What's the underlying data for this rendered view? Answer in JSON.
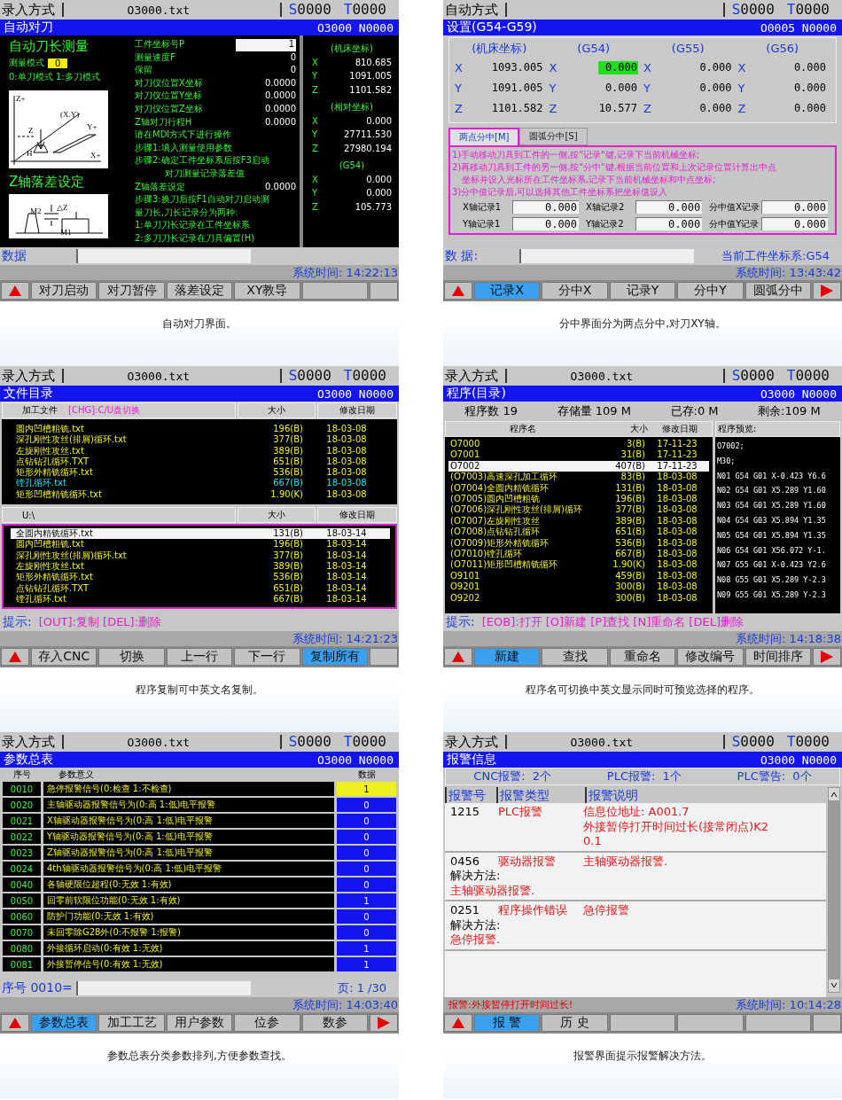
{
  "screens": [
    {
      "kind": "auto_tool",
      "status_bar": {
        "mode": "录入方式",
        "file": "O3000.txt",
        "codes": [
          {
            "letter": "S",
            "value": "0000"
          },
          {
            "letter": "T",
            "value": "0000"
          }
        ]
      },
      "title": "自动对刀",
      "program": "O3000 N0000",
      "heading": "自动刀长测量",
      "mode": {
        "label": "测量模式",
        "value": "0"
      },
      "mode_hint": "0:单刀模式 1:多刀模式",
      "diagram_labels": [
        "Z+",
        "(X.Y)",
        "Y+",
        "Z",
        "H",
        "X+"
      ],
      "heading2": "Z轴落差设定",
      "diagram2_labels": [
        "M2",
        "△Z",
        "M1"
      ],
      "params": [
        {
          "kind": "field",
          "label": "工件坐标号P",
          "value": "1"
        },
        {
          "kind": "value",
          "label": "测量速度F",
          "value": "0"
        },
        {
          "kind": "value",
          "label": "保留",
          "value": "0"
        },
        {
          "kind": "value",
          "label": "对刀仪位置X坐标",
          "value": "0.0000"
        },
        {
          "kind": "value",
          "label": "对刀仪位置Y坐标",
          "value": "0.0000"
        },
        {
          "kind": "value",
          "label": "对刀仪位置Z坐标",
          "value": "0.0000"
        },
        {
          "kind": "value",
          "label": "Z轴对刀行程H",
          "value": "0.0000"
        },
        {
          "kind": "note",
          "label": "请在MDI方式下进行操作"
        },
        {
          "kind": "note",
          "label": "步骤1:填入测量使用参数"
        },
        {
          "kind": "note",
          "label": "步骤2:确定工件坐标系后按F3启动"
        },
        {
          "kind": "indent",
          "label": "对刀测量记录落差值"
        },
        {
          "kind": "value",
          "label": "Z轴落差设定",
          "value": "0.0000"
        },
        {
          "kind": "note",
          "label": "步骤3:换刀后按F1自动对刀启动测"
        },
        {
          "kind": "note",
          "label": "量刀长,刀长记录分为两种:"
        },
        {
          "kind": "note",
          "label": "1:单刀刀长记录在工件坐标系"
        },
        {
          "kind": "note",
          "label": "2:多刀刀长记录在刀具偏置(H)"
        }
      ],
      "coords": [
        {
          "title": "(机床坐标)",
          "axes": [
            {
              "axis": "X",
              "value": "810.685"
            },
            {
              "axis": "Y",
              "value": "1091.005"
            },
            {
              "axis": "Z",
              "value": "1101.582"
            }
          ]
        },
        {
          "title": "(相对坐标)",
          "axes": [
            {
              "axis": "X",
              "value": "0.000"
            },
            {
              "axis": "Y",
              "value": "27711.530"
            },
            {
              "axis": "Z",
              "value": "27980.194"
            }
          ]
        },
        {
          "title": "(G54)",
          "axes": [
            {
              "axis": "X",
              "value": "0.000"
            },
            {
              "axis": "Y",
              "value": "0.000"
            },
            {
              "axis": "Z",
              "value": "105.773"
            }
          ]
        }
      ],
      "data_line": {
        "label": "数据"
      },
      "time": "系统时间: 14:22:13",
      "softkeys": [
        {
          "label": "对刀启动",
          "selected": false
        },
        {
          "label": "对刀暂停",
          "selected": false
        },
        {
          "label": "落差设定",
          "selected": false
        },
        {
          "label": "XY教导",
          "selected": false
        }
      ],
      "next_page": false,
      "caption": "自动对刀界面。"
    },
    {
      "kind": "offset",
      "status_bar": {
        "mode": "自动方式",
        "codes": [
          {
            "letter": "S",
            "value": "0000"
          },
          {
            "letter": "T",
            "value": "0000"
          }
        ]
      },
      "title": "设置(G54-G59)",
      "program": "O0005 N0000",
      "columns": [
        {
          "title": "(机床坐标)",
          "cells": [
            {
              "axis": "X",
              "value": "1093.005",
              "selected": false
            },
            {
              "axis": "Y",
              "value": "1091.005",
              "selected": false
            },
            {
              "axis": "Z",
              "value": "1101.582",
              "selected": false
            }
          ]
        },
        {
          "title": "(G54)",
          "cells": [
            {
              "axis": "X",
              "value": "0.000",
              "selected": true
            },
            {
              "axis": "Y",
              "value": "0.000",
              "selected": false
            },
            {
              "axis": "Z",
              "value": "10.577",
              "selected": false
            }
          ]
        },
        {
          "title": "(G55)",
          "cells": [
            {
              "axis": "X",
              "value": "0.000",
              "selected": false
            },
            {
              "axis": "Y",
              "value": "0.000",
              "selected": false
            },
            {
              "axis": "Z",
              "value": "0.000",
              "selected": false
            }
          ]
        },
        {
          "title": "(G56)",
          "cells": [
            {
              "axis": "X",
              "value": "0.000",
              "selected": false
            },
            {
              "axis": "Y",
              "value": "0.000",
              "selected": false
            },
            {
              "axis": "Z",
              "value": "0.000",
              "selected": false
            }
          ]
        }
      ],
      "tabs": [
        {
          "label": "两点分中[M]",
          "selected": true
        },
        {
          "label": "圆弧分中[S]",
          "selected": false
        }
      ],
      "instructions": [
        "1)手动移动刀具到工件的一侧,按\"记录\"键,记录下当前机械坐标;",
        "2)再移动刀具到工件的另一侧,按\"分中\"键,根据当前位置和上次记录位置计算出中点",
        "坐标并设入光标所在工件坐标系,记录下当前机械坐标和中点坐标;",
        "3)分中值记录后,可以选择其他工件坐标系把坐标值设入"
      ],
      "records": [
        {
          "label": "X轴记录1",
          "value": "0.000"
        },
        {
          "label": "X轴记录2",
          "value": "0.000"
        },
        {
          "label": "分中值X记录",
          "value": "0.000"
        },
        {
          "label": "Y轴记录1",
          "value": "0.000"
        },
        {
          "label": "Y轴记录2",
          "value": "0.000"
        },
        {
          "label": "分中值Y记录",
          "value": "0.000"
        }
      ],
      "data_line": {
        "label": "数 据:",
        "right": "当前工件坐标系:G54"
      },
      "time": "系统时间: 13:43:42",
      "softkeys": [
        {
          "label": "记录X",
          "selected": true
        },
        {
          "label": "分中X",
          "selected": false
        },
        {
          "label": "记录Y",
          "selected": false
        },
        {
          "label": "分中Y",
          "selected": false
        },
        {
          "label": "圆弧分中",
          "selected": false
        }
      ],
      "next_page": true,
      "caption": "分中界面分为两点分中,对刀XY轴。"
    },
    {
      "kind": "file_dir",
      "status_bar": {
        "mode": "录入方式",
        "file": "O3000.txt",
        "codes": [
          {
            "letter": "S",
            "value": "0000"
          },
          {
            "letter": "T",
            "value": "0000"
          }
        ]
      },
      "title": "文件目录",
      "program": "O3000 N0000",
      "tables": [
        {
          "path": "加工文件",
          "hint": "[CHG]:C/U盘切换",
          "size_header": "大小",
          "date_header": "修改日期",
          "focused": false,
          "rows": [
            {
              "name": "圆内凹槽粗铣.txt",
              "size": "196(B)",
              "date": "18-03-08",
              "selected": false
            },
            {
              "name": "深孔刚性攻丝(排屑)循环.txt",
              "size": "377(B)",
              "date": "18-03-08",
              "selected": false
            },
            {
              "name": "左旋刚性攻丝.txt",
              "size": "389(B)",
              "date": "18-03-08",
              "selected": false
            },
            {
              "name": "点钻钻孔循环.TXT",
              "size": "651(B)",
              "date": "18-03-08",
              "selected": false
            },
            {
              "name": "矩形外精铣循环.txt",
              "size": "536(B)",
              "date": "18-03-08",
              "selected": false
            },
            {
              "name": "镗孔循环.txt",
              "size": "667(B)",
              "date": "18-03-08",
              "selected": true
            },
            {
              "name": "矩形凹槽精铣循环.txt",
              "size": "1.90(K)",
              "date": "18-03-08",
              "selected": false
            }
          ]
        },
        {
          "path": "U:\\",
          "size_header": "大小",
          "date_header": "修改日期",
          "focused": true,
          "rows": [
            {
              "name": "全圆内精铣循环.txt",
              "size": "131(B)",
              "date": "18-03-14",
              "selected": true
            },
            {
              "name": "圆内凹槽粗铣.txt",
              "size": "196(B)",
              "date": "18-03-14",
              "selected": false
            },
            {
              "name": "深孔刚性攻丝(排屑)循环.txt",
              "size": "377(B)",
              "date": "18-03-14",
              "selected": false
            },
            {
              "name": "左旋刚性攻丝.txt",
              "size": "389(B)",
              "date": "18-03-14",
              "selected": false
            },
            {
              "name": "矩形外精铣循环.txt",
              "size": "536(B)",
              "date": "18-03-14",
              "selected": false
            },
            {
              "name": "点钻钻孔循环.TXT",
              "size": "651(B)",
              "date": "18-03-14",
              "selected": false
            },
            {
              "name": "镗孔循环.txt",
              "size": "667(B)",
              "date": "18-03-14",
              "selected": false
            }
          ]
        }
      ],
      "prompt": {
        "label": "提示:",
        "text": "[OUT]:复制 [DEL]:删除"
      },
      "time": "系统时间: 14:21:23",
      "softkeys": [
        {
          "label": "存入CNC",
          "selected": false
        },
        {
          "label": "切换",
          "selected": false
        },
        {
          "label": "上一行",
          "selected": false
        },
        {
          "label": "下一行",
          "selected": false
        },
        {
          "label": "复制所有",
          "selected": true
        }
      ],
      "next_page": false,
      "caption": "程序复制可中英文名复制。"
    },
    {
      "kind": "program_list",
      "status_bar": {
        "mode": "录入方式",
        "file": "O3000.txt",
        "codes": [
          {
            "letter": "S",
            "value": "0000"
          },
          {
            "letter": "T",
            "value": "0000"
          }
        ]
      },
      "title": "程序(目录)",
      "program": "O3000 N0000",
      "summary": [
        "程序数 19",
        "存储量 109 M",
        "已存:0 M",
        "剩余:109 M"
      ],
      "columns": [
        "程序名",
        "大小",
        "修改日期"
      ],
      "rows": [
        {
          "name": "O7000",
          "size": "3(B)",
          "date": "17-11-23",
          "selected": false
        },
        {
          "name": "O7001",
          "size": "31(B)",
          "date": "17-11-23",
          "selected": false
        },
        {
          "name": "O7002",
          "size": "407(B)",
          "date": "17-11-23",
          "selected": true
        },
        {
          "name": "(O7003)高速深孔加工循环",
          "size": "83(B)",
          "date": "18-03-08",
          "selected": false
        },
        {
          "name": "(O7004)全圆内精铣循环",
          "size": "131(B)",
          "date": "18-03-08",
          "selected": false
        },
        {
          "name": "(O7005)圆内凹槽粗铣",
          "size": "196(B)",
          "date": "18-03-08",
          "selected": false
        },
        {
          "name": "(O7006)深孔刚性攻丝(排屑)循环",
          "size": "377(B)",
          "date": "18-03-08",
          "selected": false
        },
        {
          "name": "(O7007)左旋刚性攻丝",
          "size": "389(B)",
          "date": "18-03-08",
          "selected": false
        },
        {
          "name": "(O7008)点钻钻孔循环",
          "size": "651(B)",
          "date": "18-03-08",
          "selected": false
        },
        {
          "name": "(O7009)矩形外精铣循环",
          "size": "536(B)",
          "date": "18-03-08",
          "selected": false
        },
        {
          "name": "(O7010)镗孔循环",
          "size": "667(B)",
          "date": "18-03-08",
          "selected": false
        },
        {
          "name": "(O7011)矩形凹槽精铣循环",
          "size": "1.90(K)",
          "date": "18-03-08",
          "selected": false
        },
        {
          "name": "O9101",
          "size": "459(B)",
          "date": "18-03-08",
          "selected": false
        },
        {
          "name": "O9201",
          "size": "300(B)",
          "date": "18-03-08",
          "selected": false
        },
        {
          "name": "O9202",
          "size": "300(B)",
          "date": "18-03-08",
          "selected": false
        }
      ],
      "preview_title": "程序预览:",
      "preview": [
        "O7002;",
        "M30;",
        "N01 G54 G01 X-0.423 Y6.6",
        "N02 G54 G01 X5.289 Y1.60",
        "N03 G54 G01 X5.289 Y1.60",
        "N04 G54 G03 X5.894 Y1.35",
        "N05 G54 G01 X5.894 Y1.35",
        "N06 G54 G01 X56.072 Y-1.",
        "N07 G55 G01 X-0.423 Y2.6",
        "N08 G55 G01 X5.289 Y-2.3",
        "N09 G55 G01 X5.289 Y-2.3"
      ],
      "prompt": {
        "label": "提示:",
        "text": "[EOB]:打开 [O]新建 [P]查找 [N]重命名 [DEL]删除"
      },
      "time": "系统时间: 14:18:38",
      "softkeys": [
        {
          "label": "新建",
          "selected": true
        },
        {
          "label": "查找",
          "selected": false
        },
        {
          "label": "重命名",
          "selected": false
        },
        {
          "label": "修改编号",
          "selected": false
        },
        {
          "label": "时间排序",
          "selected": false
        }
      ],
      "next_page": true,
      "caption": "程序名可切换中英文显示同时可预览选择的程序。"
    },
    {
      "kind": "params",
      "status_bar": {
        "mode": "录入方式",
        "file": "O3000.txt",
        "codes": [
          {
            "letter": "S",
            "value": "0000"
          },
          {
            "letter": "T",
            "value": "0000"
          }
        ]
      },
      "title": "参数总表",
      "program": "O3000 N0000",
      "columns": [
        "序号",
        "参数意义",
        "数据"
      ],
      "rows": [
        {
          "no": "0010",
          "desc": "急停报警信号(0:检查 1:不检查)",
          "value": "1",
          "selected": true
        },
        {
          "no": "0020",
          "desc": "主轴驱动器报警信号为(0:高 1:低)电平报警",
          "value": "0",
          "selected": false
        },
        {
          "no": "0021",
          "desc": "X轴驱动器报警信号为(0:高 1:低)电平报警",
          "value": "0",
          "selected": false
        },
        {
          "no": "0022",
          "desc": "Y轴驱动器报警信号为(0:高 1:低)电平报警",
          "value": "0",
          "selected": false
        },
        {
          "no": "0023",
          "desc": "Z轴驱动器报警信号为(0:高 1:低)电平报警",
          "value": "0",
          "selected": false
        },
        {
          "no": "0024",
          "desc": "4th轴驱动器报警信号为(0:高 1:低)电平报警",
          "value": "0",
          "selected": false
        },
        {
          "no": "0040",
          "desc": "各轴硬限位超程(0:无效 1:有效)",
          "value": "0",
          "selected": false
        },
        {
          "no": "0050",
          "desc": "回零前软限位功能(0:无效 1:有效)",
          "value": "1",
          "selected": false
        },
        {
          "no": "0060",
          "desc": "防护门功能(0:无效 1:有效)",
          "value": "0",
          "selected": false
        },
        {
          "no": "0070",
          "desc": "未回零除G28外(0:不报警 1:报警)",
          "value": "0",
          "selected": false
        },
        {
          "no": "0080",
          "desc": "外接循环启动(0:有效 1:无效)",
          "value": "1",
          "selected": false
        },
        {
          "no": "0081",
          "desc": "外接暂停信号(0:有效 1:无效)",
          "value": "1",
          "selected": false
        }
      ],
      "data_line": {
        "label": "序号 0010=",
        "right": "页: 1 /30"
      },
      "time": "系统时间: 14:03:40",
      "softkeys": [
        {
          "label": "参数总表",
          "selected": true
        },
        {
          "label": "加工工艺",
          "selected": false
        },
        {
          "label": "用户参数",
          "selected": false
        },
        {
          "label": "位参",
          "selected": false
        },
        {
          "label": "数参",
          "selected": false
        }
      ],
      "next_page": true,
      "caption": "参数总表分类参数排列,方便参数查找。"
    },
    {
      "kind": "alarms",
      "status_bar": {
        "mode": "录入方式",
        "file": "O3000.txt",
        "codes": [
          {
            "letter": "S",
            "value": "0000"
          },
          {
            "letter": "T",
            "value": "0000"
          }
        ]
      },
      "title": "报警信息",
      "program": "O3000 N0000",
      "counts": [
        "CNC报警:  2个",
        "PLC报警:  1个",
        "PLC警告:  0个"
      ],
      "columns": [
        "报警号",
        "报警类型",
        "报警说明"
      ],
      "alarms": [
        {
          "no": "1215",
          "type": "PLC报警",
          "desc": [
            "信息位地址: A001.7",
            "外接暂停打开时间过长(接常闭点)K2",
            "0.1"
          ]
        },
        {
          "no": "0456",
          "type": "驱动器报警",
          "desc": [
            "主轴驱动器报警."
          ],
          "solution_label": "解决方法:",
          "solution": "主轴驱动器报警."
        },
        {
          "no": "0251",
          "type": "程序操作错误",
          "desc": [
            "急停报警"
          ],
          "solution_label": "解决方法:",
          "solution": "急停报警."
        }
      ],
      "ticker": "报警:外接暂停打开时间过长!",
      "time": "系统时间: 10:14:28",
      "softkeys": [
        {
          "label": "报 警",
          "selected": true
        },
        {
          "label": "历 史",
          "selected": false
        }
      ],
      "next_page": false,
      "caption": "报警界面提示报警解决方法。"
    }
  ]
}
